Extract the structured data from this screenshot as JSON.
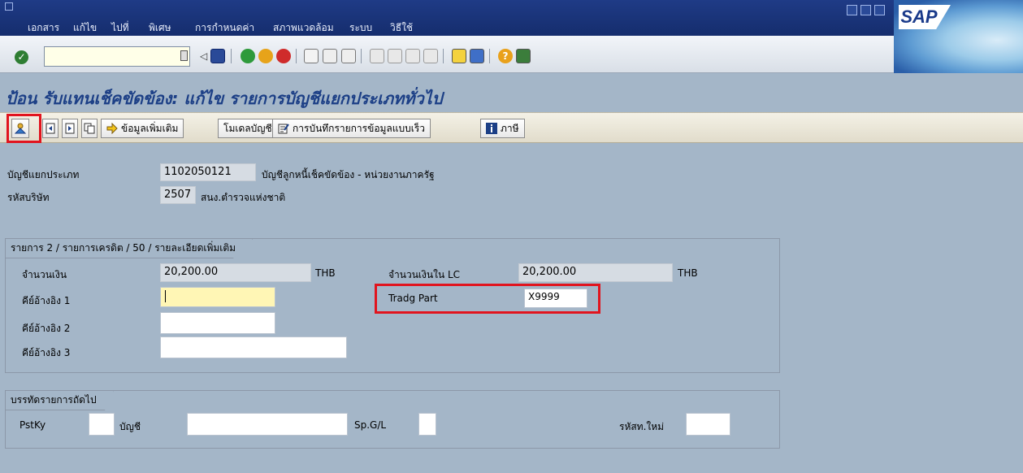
{
  "menubar": {
    "items": [
      "เอกสาร",
      "แก้ไข",
      "ไปที่",
      "พิเศษ",
      "การกำหนดค่า",
      "สภาพแวดล้อม",
      "ระบบ",
      "วิธีใช้"
    ],
    "logo": "SAP"
  },
  "stdbar": {
    "command_value": "",
    "icons": [
      "check-icon",
      "back-icon",
      "save-icon",
      "exit-icon",
      "cancel-icon",
      "print-icon",
      "find-icon",
      "find-next-icon",
      "first-page-icon",
      "prev-page-icon",
      "next-page-icon",
      "last-page-icon",
      "new-session-icon",
      "shortcut-icon",
      "help-icon",
      "layout-icon"
    ]
  },
  "page": {
    "title": "ป้อน รับแทนเช็คขัดข้อง: แก้ไข รายการบัญชีแยกประเภททั่วไป"
  },
  "appbar": {
    "more_data_label": "ข้อมูลเพิ่มเติม",
    "acct_model_label": "โมเดลบัญชี",
    "fast_entry_label": "การบันทึกรายการข้อมูลแบบเร็ว",
    "taxes_label": "ภาษี"
  },
  "header": {
    "gl_account_label": "บัญชีแยกประเภท",
    "gl_account_value": "1102050121",
    "gl_account_desc": "บัญชีลูกหนี้เช็คขัดข้อง - หน่วยงานภาครัฐ",
    "company_code_label": "รหัสบริษัท",
    "company_code_value": "2507",
    "company_code_desc": "สนง.ตำรวจแห่งชาติ"
  },
  "item_group": {
    "title": "รายการ 2 / รายการเครดิต / 50 / รายละเอียดเพิ่มเติม",
    "amount_label": "จำนวนเงิน",
    "amount_value": "20,200.00",
    "amount_currency": "THB",
    "amount_lc_label": "จำนวนเงินใน LC",
    "amount_lc_value": "20,200.00",
    "amount_lc_currency": "THB",
    "ref_key1_label": "คีย์อ้างอิง 1",
    "ref_key1_value": "",
    "ref_key2_label": "คีย์อ้างอิง 2",
    "ref_key2_value": "",
    "ref_key3_label": "คีย์อ้างอิง 3",
    "ref_key3_value": "",
    "tradg_part_label": "Tradg Part",
    "tradg_part_value": "X9999"
  },
  "next_line_group": {
    "title": "บรรทัดรายการถัดไป",
    "pstky_label": "PstKy",
    "pstky_value": "",
    "account_label": "บัญชี",
    "account_value": "",
    "spgl_label": "Sp.G/L",
    "spgl_value": "",
    "new_co_label": "รหัสท.ใหม่",
    "new_co_value": ""
  }
}
